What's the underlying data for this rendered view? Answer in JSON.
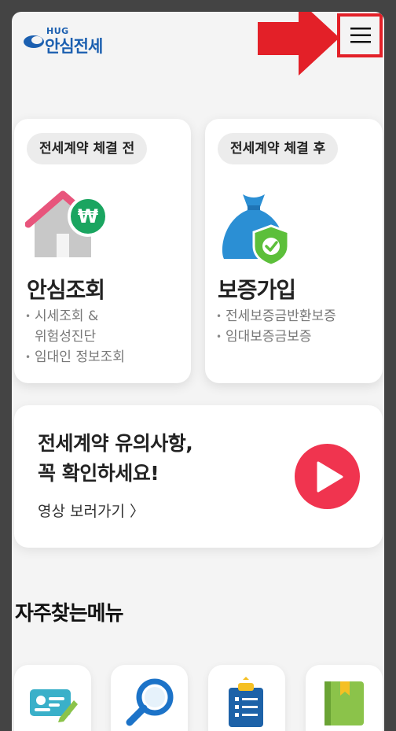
{
  "header": {
    "logo_small": "HUG",
    "logo_text": "안심전세",
    "menu_icon": "hamburger-icon"
  },
  "cards": [
    {
      "pill": "전세계약 체결 전",
      "title": "안심조회",
      "bullets": [
        "시세조회 &",
        "위험성진단",
        "임대인 정보조회"
      ],
      "icon": "house-won-icon"
    },
    {
      "pill": "전세계약 체결 후",
      "title": "보증가입",
      "bullets": [
        "전세보증금반환보증",
        "임대보증금보증"
      ],
      "icon": "money-bag-shield-icon"
    }
  ],
  "video": {
    "title_line1": "전세계약 유의사항,",
    "title_line2": "꼭 확인하세요!",
    "link": "영상 보러가기 〉",
    "icon": "play-icon"
  },
  "quick_menu": {
    "title": "자주찾는메뉴",
    "icons": [
      "id-card-pen-icon",
      "magnifier-icon",
      "clipboard-list-icon",
      "green-book-icon"
    ]
  },
  "colors": {
    "brand_blue": "#1b5fb0",
    "annotation_red": "#e32028",
    "play_red": "#f0344f",
    "won_green": "#1aa560",
    "bag_blue": "#2b8fd4",
    "shield_green": "#5cbf3a"
  }
}
